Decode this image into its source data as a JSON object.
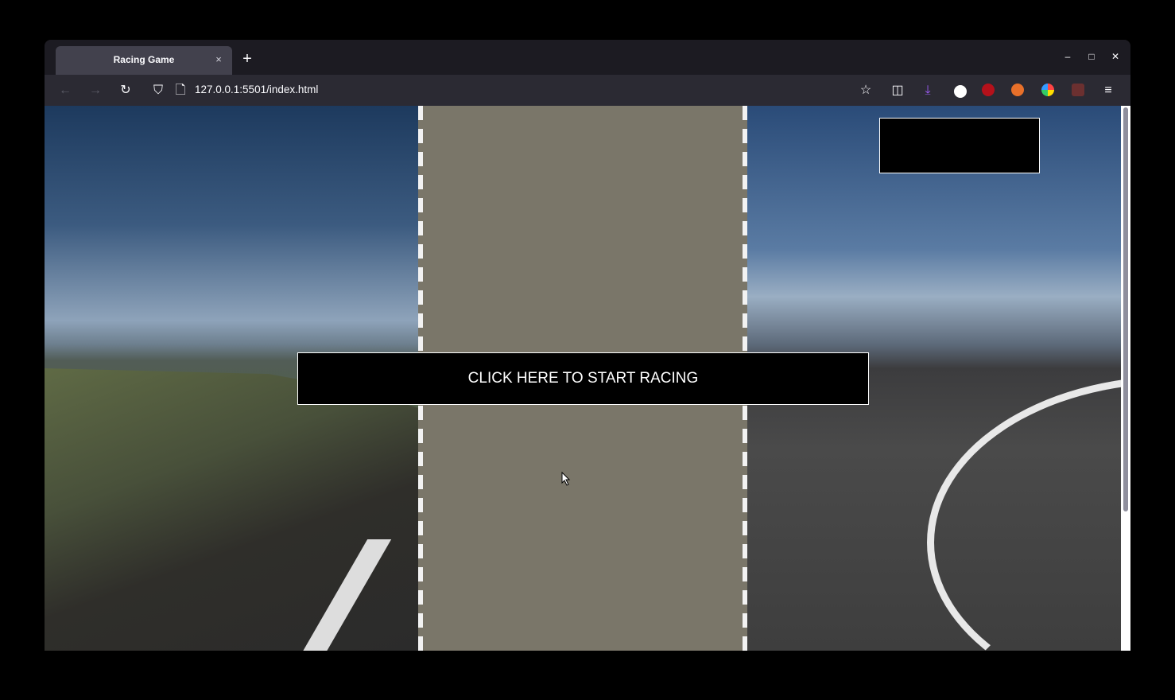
{
  "browser": {
    "tab_title": "Racing Game",
    "tab_close": "×",
    "new_tab": "+",
    "url": "127.0.0.1:5501/index.html",
    "window_controls": {
      "minimize": "–",
      "maximize": "□",
      "close": "✕"
    }
  },
  "toolbar": {
    "back": "←",
    "forward": "→",
    "reload": "↻",
    "shield": "⛉",
    "page": "🗋",
    "bookmark": "☆",
    "pocket": "◫",
    "download": "⤓",
    "menu": "≡"
  },
  "game": {
    "start_label": "CLICK HERE TO START RACING",
    "score_text": ""
  },
  "colors": {
    "track": "#7a7669",
    "panel": "#000000"
  }
}
